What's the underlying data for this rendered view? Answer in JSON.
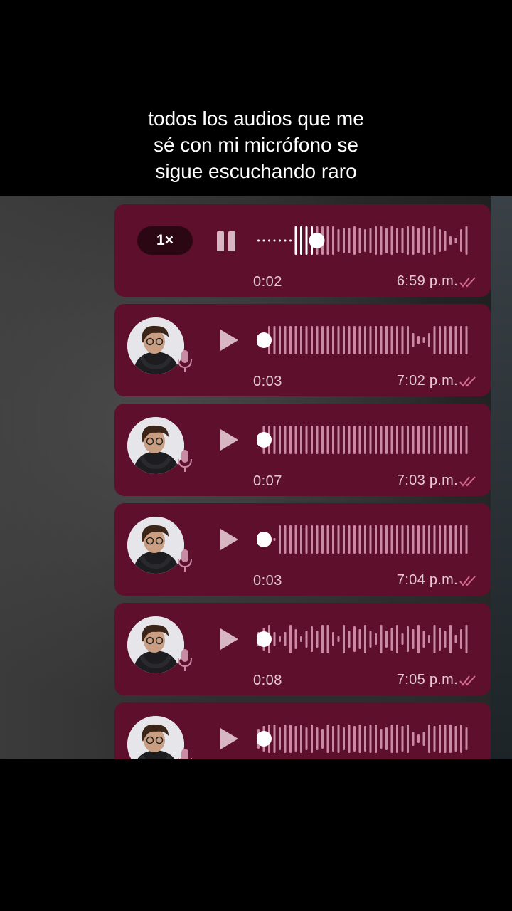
{
  "caption": {
    "line1": "todos los audios que me",
    "line2": "sé con mi micrófono se",
    "line3": "sigue escuchando raro"
  },
  "colors": {
    "bubble": "#5e0f2c",
    "bar_played": "#ffffff",
    "bar_unplayed": "#c98aa3",
    "ticks": "#d66a8e"
  },
  "messages": [
    {
      "playing": true,
      "speed": "1×",
      "duration": "0:02",
      "time": "6:59 p.m.",
      "progress": 0.27
    },
    {
      "playing": false,
      "duration": "0:03",
      "time": "7:02 p.m.",
      "progress": 0
    },
    {
      "playing": false,
      "duration": "0:07",
      "time": "7:03 p.m.",
      "progress": 0
    },
    {
      "playing": false,
      "duration": "0:03",
      "time": "7:04 p.m.",
      "progress": 0
    },
    {
      "playing": false,
      "duration": "0:08",
      "time": "7:05 p.m.",
      "progress": 0
    },
    {
      "playing": false,
      "duration": "",
      "time": "",
      "progress": 0
    }
  ],
  "icons": {
    "pause": "pause-icon",
    "play": "play-icon",
    "mic": "mic-icon",
    "ticks": "double-check-icon",
    "avatar": "avatar"
  }
}
